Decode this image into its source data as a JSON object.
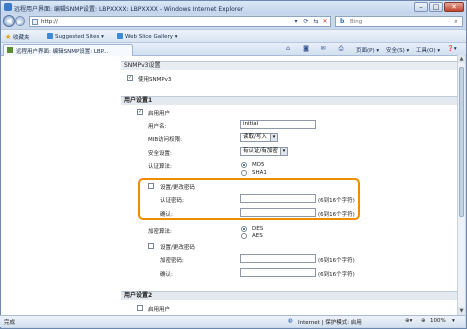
{
  "window": {
    "title": "远程用户界面: 编辑SNMP设置: LBPXXXX: LBPXXXX - Windows Internet Explorer"
  },
  "address": {
    "url": "http://",
    "search_text": "Bing"
  },
  "favorites": {
    "favorites_label": "收藏夹",
    "suggested_sites": "Suggested Sites ▾",
    "web_slice_gallery": "Web Slice Gallery ▾"
  },
  "tab": {
    "label": "远程用户界面: 编辑SNMP设置: LBP..."
  },
  "commands": {
    "page": "页面(P) ▾",
    "safety": "安全(S) ▾",
    "tools": "工具(O) ▾",
    "help": "❓▾"
  },
  "snmpv3": {
    "header": "SNMPv3设置",
    "enable_label": "使用SNMPv3",
    "enabled": true
  },
  "user1": {
    "header": "用户设置1",
    "enable_user_label": "启用用户",
    "username_label": "用户名:",
    "username_value": "initial",
    "access_label": "MIB访问权限:",
    "access_value": "读取/写入",
    "security_label": "安全设置:",
    "security_value": "有认证/有加密",
    "auth_algo_label": "认证算法:",
    "auth_options": [
      "MD5",
      "SHA1"
    ],
    "set_auth_password_label": "设置/更改密码",
    "auth_password_label": "认证密码:",
    "confirm_label": "确认:",
    "char_hint": "(6到16个字符)",
    "encrypt_algo_label": "加密算法:",
    "encrypt_options": [
      "DES",
      "AES"
    ],
    "set_encrypt_password_label": "设置/更改密码",
    "encrypt_password_label": "加密密码:",
    "confirm2_label": "确认:"
  },
  "user2": {
    "header": "用户设置2",
    "enable_user_label": "启用用户"
  },
  "status": {
    "left": "完成",
    "zone": "Internet | 保护模式: 启用",
    "zoom": "100%"
  }
}
